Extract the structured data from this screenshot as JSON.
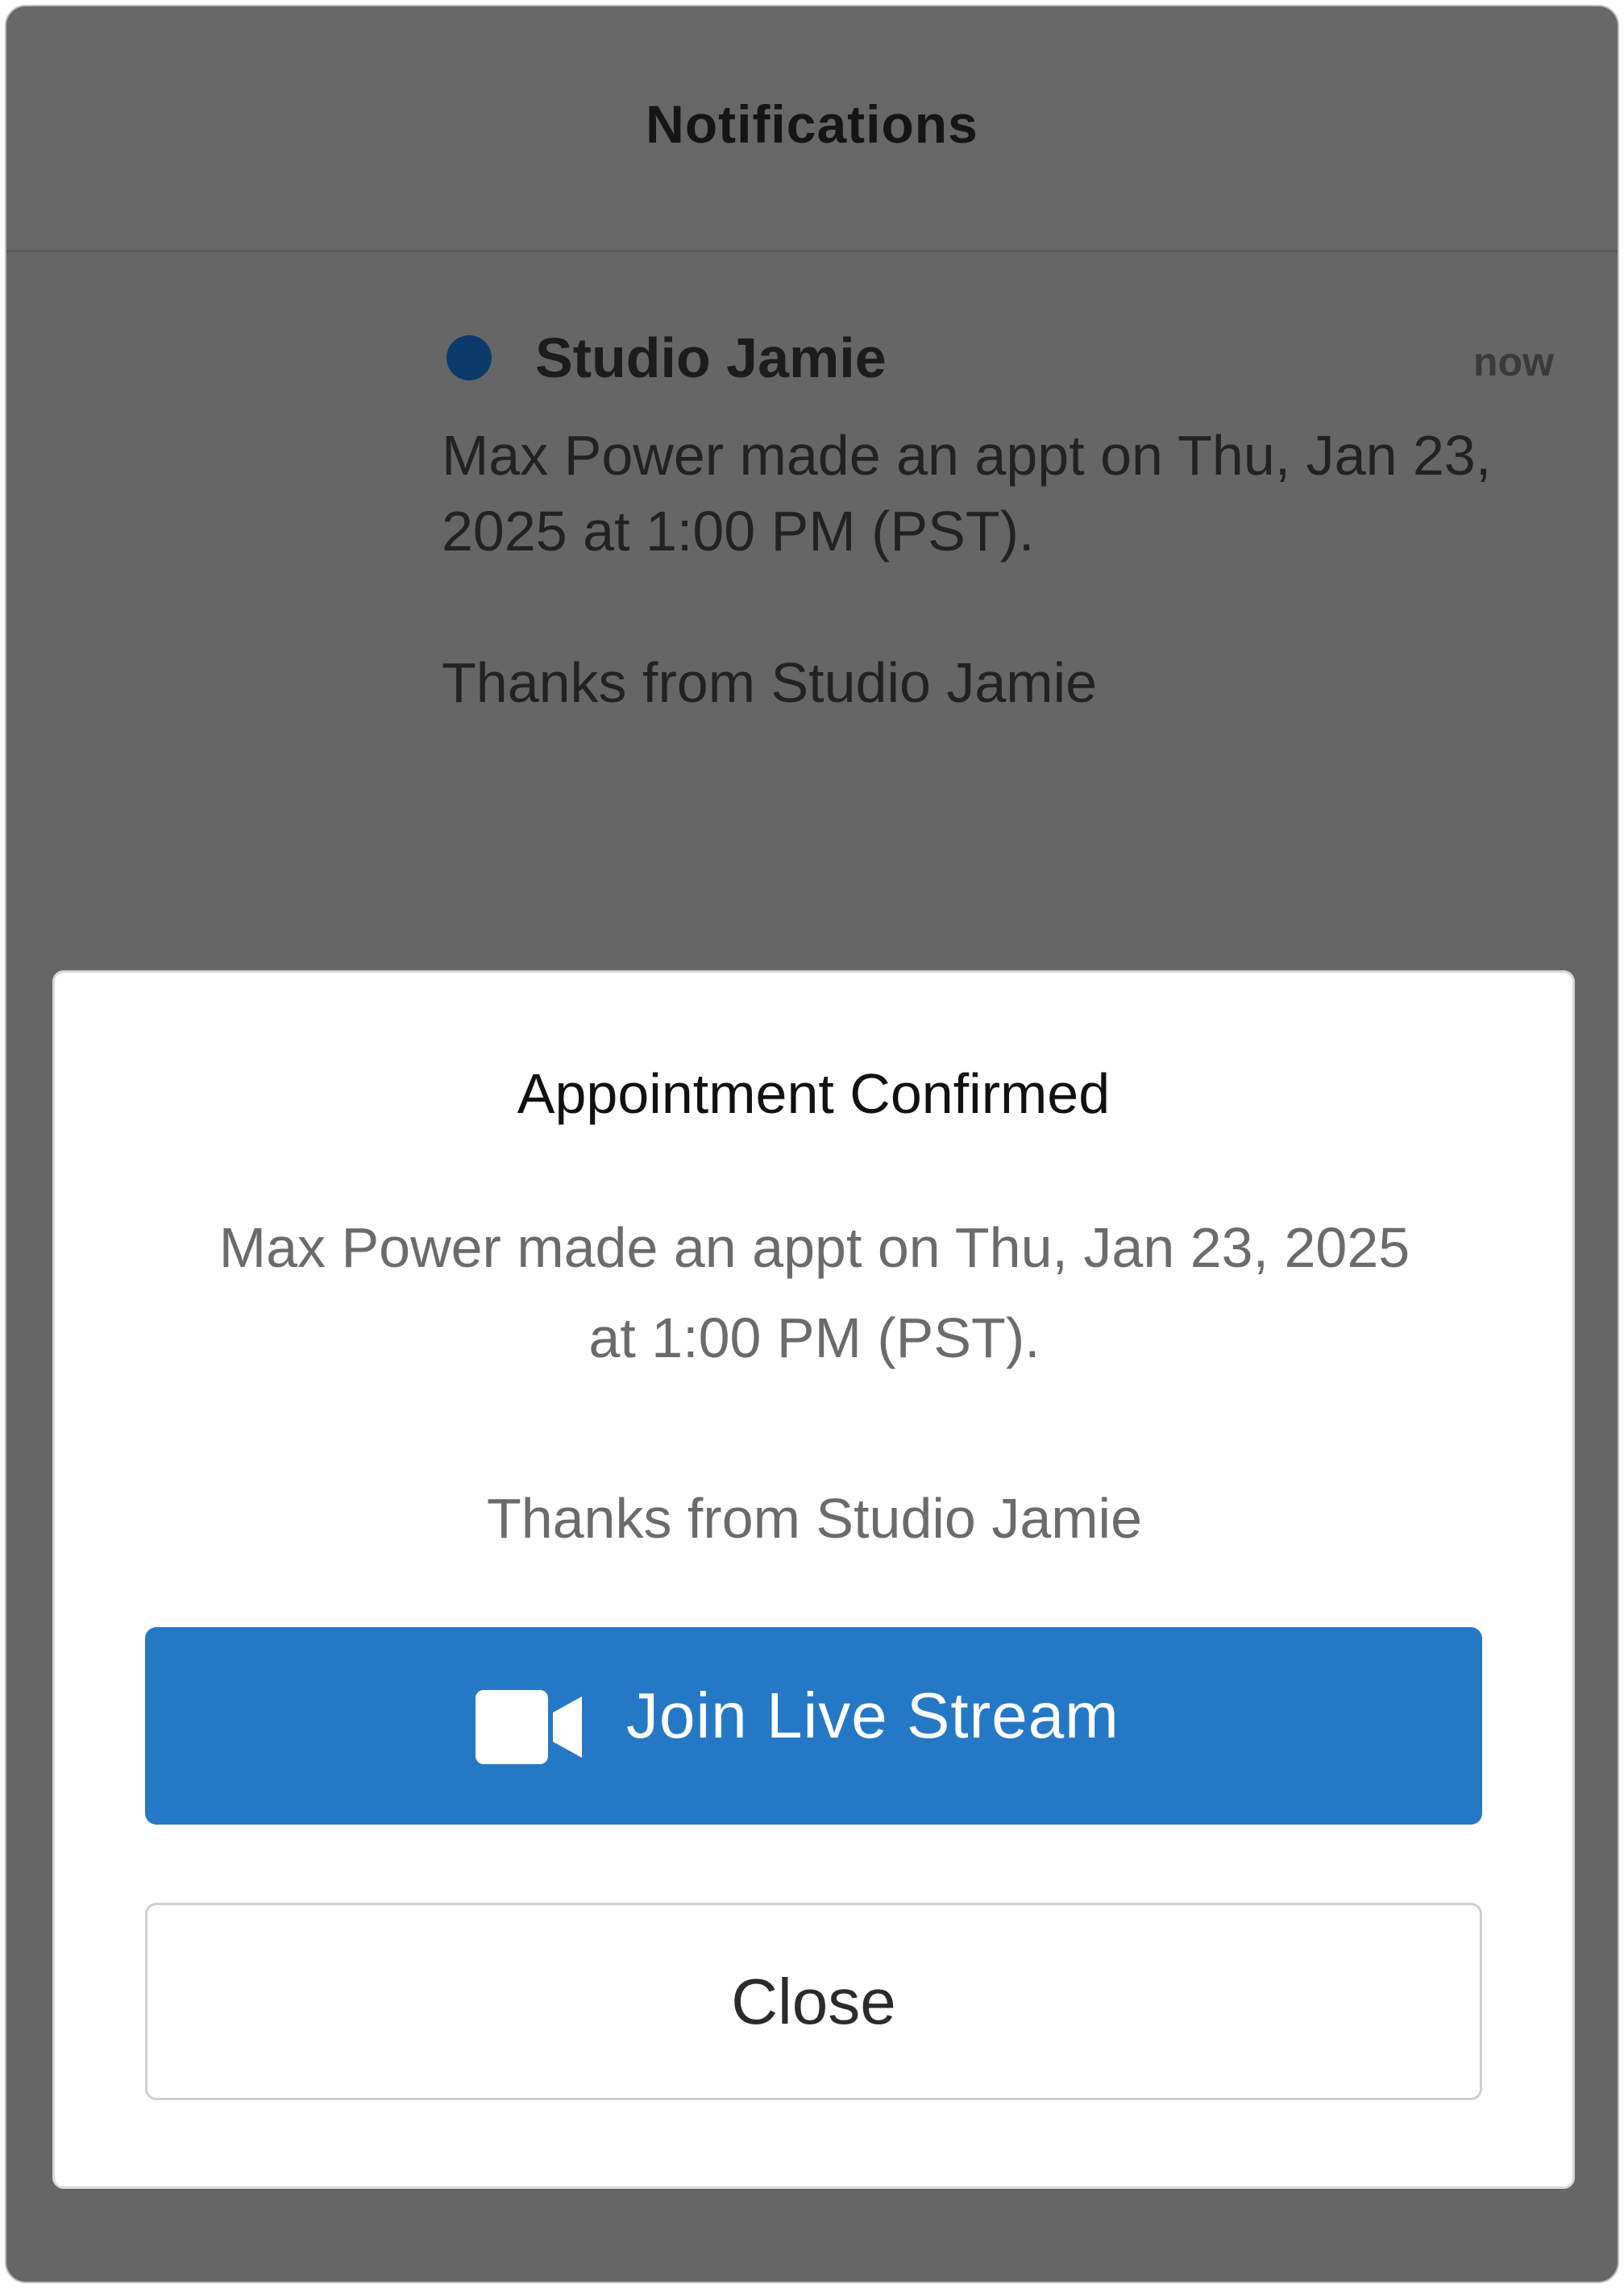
{
  "header": {
    "title": "Notifications"
  },
  "notification": {
    "sender": "Studio Jamie",
    "time": "now",
    "message_line": "Max Power made an appt  on Thu, Jan 23, 2025 at 1:00 PM (PST).",
    "signoff": "Thanks from Studio Jamie",
    "unread": true,
    "dot_color": "#0c3a6b"
  },
  "modal": {
    "title": "Appointment Confirmed",
    "message_line": "Max Power made an appt  on Thu, Jan 23, 2025 at 1:00 PM (PST).",
    "signoff": "Thanks from Studio Jamie",
    "join_button": {
      "label": "Join Live Stream",
      "icon": "video-camera-icon",
      "color": "#2578c6"
    },
    "close_button": {
      "label": "Close"
    }
  }
}
